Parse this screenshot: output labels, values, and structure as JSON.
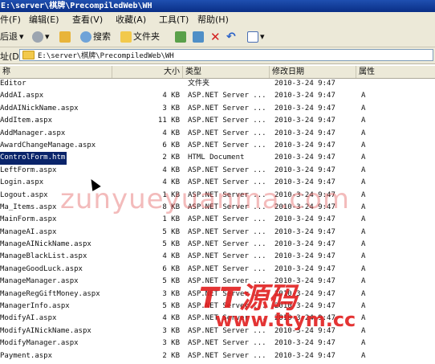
{
  "window": {
    "title": "E:\\server\\棋牌\\PrecompiledWeb\\WH"
  },
  "menu": {
    "file": "件(F)",
    "edit": "编辑(E)",
    "view": "查看(V)",
    "favorites": "收藏(A)",
    "tools": "工具(T)",
    "help": "帮助(H)"
  },
  "toolbar": {
    "back": "后退",
    "search": "搜索",
    "folders": "文件夹"
  },
  "address": {
    "label": "址(D)",
    "path": "E:\\server\\棋牌\\PrecompiledWeb\\WH"
  },
  "columns": {
    "name": "称",
    "size": "大小",
    "type": "类型",
    "modified": "修改日期",
    "attr": "属性"
  },
  "files": [
    {
      "name": "Editor",
      "size": "",
      "type": "文件夹",
      "date": "2010-3-24 9:47",
      "attr": ""
    },
    {
      "name": "AddAI.aspx",
      "size": "4 KB",
      "type": "ASP.NET Server ...",
      "date": "2010-3-24 9:47",
      "attr": "A"
    },
    {
      "name": "AddAINickName.aspx",
      "size": "3 KB",
      "type": "ASP.NET Server ...",
      "date": "2010-3-24 9:47",
      "attr": "A"
    },
    {
      "name": "AddItem.aspx",
      "size": "11 KB",
      "type": "ASP.NET Server ...",
      "date": "2010-3-24 9:47",
      "attr": "A"
    },
    {
      "name": "AddManager.aspx",
      "size": "4 KB",
      "type": "ASP.NET Server ...",
      "date": "2010-3-24 9:47",
      "attr": "A"
    },
    {
      "name": "AwardChangeManage.aspx",
      "size": "6 KB",
      "type": "ASP.NET Server ...",
      "date": "2010-3-24 9:47",
      "attr": "A"
    },
    {
      "name": "ControlForm.htm",
      "size": "2 KB",
      "type": "HTML Document",
      "date": "2010-3-24 9:47",
      "attr": "A"
    },
    {
      "name": "LeftForm.aspx",
      "size": "4 KB",
      "type": "ASP.NET Server ...",
      "date": "2010-3-24 9:47",
      "attr": "A"
    },
    {
      "name": "Login.aspx",
      "size": "4 KB",
      "type": "ASP.NET Server ...",
      "date": "2010-3-24 9:47",
      "attr": "A"
    },
    {
      "name": "Logout.aspx",
      "size": "1 KB",
      "type": "ASP.NET Server ...",
      "date": "2010-3-24 9:47",
      "attr": "A"
    },
    {
      "name": "Ma_Items.aspx",
      "size": "8 KB",
      "type": "ASP.NET Server ...",
      "date": "2010-3-24 9:47",
      "attr": "A"
    },
    {
      "name": "MainForm.aspx",
      "size": "1 KB",
      "type": "ASP.NET Server ...",
      "date": "2010-3-24 9:47",
      "attr": "A"
    },
    {
      "name": "ManageAI.aspx",
      "size": "5 KB",
      "type": "ASP.NET Server ...",
      "date": "2010-3-24 9:47",
      "attr": "A"
    },
    {
      "name": "ManageAINickName.aspx",
      "size": "5 KB",
      "type": "ASP.NET Server ...",
      "date": "2010-3-24 9:47",
      "attr": "A"
    },
    {
      "name": "ManageBlackList.aspx",
      "size": "4 KB",
      "type": "ASP.NET Server ...",
      "date": "2010-3-24 9:47",
      "attr": "A"
    },
    {
      "name": "ManageGoodLuck.aspx",
      "size": "6 KB",
      "type": "ASP.NET Server ...",
      "date": "2010-3-24 9:47",
      "attr": "A"
    },
    {
      "name": "ManageManager.aspx",
      "size": "5 KB",
      "type": "ASP.NET Server ...",
      "date": "2010-3-24 9:47",
      "attr": "A"
    },
    {
      "name": "ManageRegGiftMoney.aspx",
      "size": "3 KB",
      "type": "ASP.NET Server ...",
      "date": "2010-3-24 9:47",
      "attr": "A"
    },
    {
      "name": "ManagerInfo.aspx",
      "size": "5 KB",
      "type": "ASP.NET Server ...",
      "date": "2010-3-24 9:47",
      "attr": "A"
    },
    {
      "name": "ModifyAI.aspx",
      "size": "4 KB",
      "type": "ASP.NET Server ...",
      "date": "2010-3-24 9:47",
      "attr": "A"
    },
    {
      "name": "ModifyAINickName.aspx",
      "size": "3 KB",
      "type": "ASP.NET Server ...",
      "date": "2010-3-24 9:47",
      "attr": "A"
    },
    {
      "name": "ModifyManager.aspx",
      "size": "3 KB",
      "type": "ASP.NET Server ...",
      "date": "2010-3-24 9:47",
      "attr": "A"
    },
    {
      "name": "Payment.aspx",
      "size": "2 KB",
      "type": "ASP.NET Server ...",
      "date": "2010-3-24 9:47",
      "attr": "A"
    }
  ],
  "selected_index": 6,
  "watermark": {
    "main": "zunyueyuanma.com",
    "brand": "TT源码",
    "url": "www.ttym.cc"
  },
  "colors": {
    "title_bar": "#0a2f86",
    "selection": "#0a246a",
    "chrome": "#ece9d8",
    "watermark": "#e11e1e"
  }
}
